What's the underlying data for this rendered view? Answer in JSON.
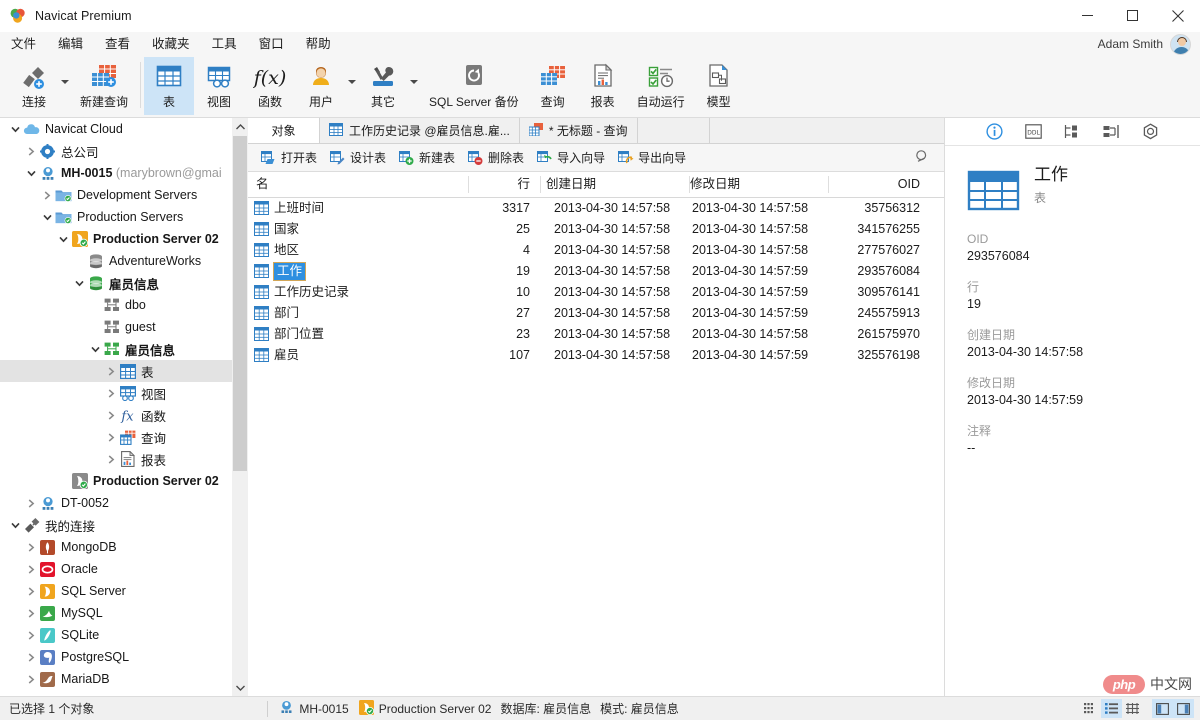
{
  "window": {
    "title": "Navicat Premium",
    "logo_icon": "navicat-logo-icon",
    "minimize_icon": "minimize-icon",
    "maximize_icon": "maximize-icon",
    "close_icon": "close-icon"
  },
  "menubar": {
    "items": [
      {
        "label": "文件"
      },
      {
        "label": "编辑"
      },
      {
        "label": "查看"
      },
      {
        "label": "收藏夹"
      },
      {
        "label": "工具"
      },
      {
        "label": "窗口"
      },
      {
        "label": "帮助"
      }
    ],
    "user_name": "Adam Smith",
    "avatar_icon": "avatar"
  },
  "ribbon": {
    "items": [
      {
        "label": "连接",
        "icon": "connection-icon",
        "has_caret": true,
        "active": false
      },
      {
        "label": "新建查询",
        "icon": "new-query-icon",
        "has_caret": false,
        "active": false
      },
      {
        "label": "表",
        "icon": "table-icon",
        "has_caret": false,
        "active": true
      },
      {
        "label": "视图",
        "icon": "view-icon",
        "has_caret": false,
        "active": false
      },
      {
        "label": "函数",
        "icon": "function-icon",
        "has_caret": false,
        "active": false
      },
      {
        "label": "用户",
        "icon": "user-icon",
        "has_caret": true,
        "active": false
      },
      {
        "label": "其它",
        "icon": "other-tools-icon",
        "has_caret": true,
        "active": false
      },
      {
        "label": "SQL Server 备份",
        "icon": "backup-icon",
        "has_caret": false,
        "active": false
      },
      {
        "label": "查询",
        "icon": "query-icon",
        "has_caret": false,
        "active": false
      },
      {
        "label": "报表",
        "icon": "report-icon",
        "has_caret": false,
        "active": false
      },
      {
        "label": "自动运行",
        "icon": "automation-icon",
        "has_caret": false,
        "active": false
      },
      {
        "label": "模型",
        "icon": "model-icon",
        "has_caret": false,
        "active": false
      }
    ]
  },
  "sidebar": {
    "scroll_up_icon": "chevron-up-icon",
    "scroll_down_icon": "chevron-down-icon",
    "items": [
      {
        "label": "Navicat Cloud",
        "icon": "cloud-icon",
        "indent": 0,
        "twisty": "down",
        "selected": false,
        "bold": false,
        "suffix": ""
      },
      {
        "label": "总公司",
        "icon": "gear-blue-icon",
        "indent": 1,
        "twisty": "right",
        "selected": false,
        "bold": false,
        "suffix": ""
      },
      {
        "label": "MH-0015",
        "icon": "project-icon",
        "indent": 1,
        "twisty": "down",
        "selected": false,
        "bold": true,
        "suffix": "(marybrown@gmai"
      },
      {
        "label": "Development Servers",
        "icon": "folder-ok-icon",
        "indent": 2,
        "twisty": "right",
        "selected": false,
        "bold": false,
        "suffix": ""
      },
      {
        "label": "Production Servers",
        "icon": "folder-ok-icon",
        "indent": 2,
        "twisty": "down",
        "selected": false,
        "bold": false,
        "suffix": ""
      },
      {
        "label": "Production Server 02",
        "icon": "sqlserver-ok-icon",
        "indent": 3,
        "twisty": "down",
        "selected": false,
        "bold": true,
        "suffix": ""
      },
      {
        "label": "AdventureWorks",
        "icon": "database-gray-icon",
        "indent": 4,
        "twisty": "none",
        "selected": false,
        "bold": false,
        "suffix": ""
      },
      {
        "label": "雇员信息",
        "icon": "database-green-icon",
        "indent": 4,
        "twisty": "down",
        "selected": false,
        "bold": true,
        "suffix": ""
      },
      {
        "label": "dbo",
        "icon": "schema-gray-icon",
        "indent": 5,
        "twisty": "none",
        "selected": false,
        "bold": false,
        "suffix": ""
      },
      {
        "label": "guest",
        "icon": "schema-gray-icon",
        "indent": 5,
        "twisty": "none",
        "selected": false,
        "bold": false,
        "suffix": ""
      },
      {
        "label": "雇员信息",
        "icon": "schema-green-icon",
        "indent": 5,
        "twisty": "down",
        "selected": false,
        "bold": true,
        "suffix": ""
      },
      {
        "label": "表",
        "icon": "table-icon",
        "indent": 6,
        "twisty": "right",
        "selected": true,
        "bold": false,
        "suffix": ""
      },
      {
        "label": "视图",
        "icon": "view-icon",
        "indent": 6,
        "twisty": "right",
        "selected": false,
        "bold": false,
        "suffix": ""
      },
      {
        "label": "函数",
        "icon": "function-icon",
        "indent": 6,
        "twisty": "right",
        "selected": false,
        "bold": false,
        "suffix": ""
      },
      {
        "label": "查询",
        "icon": "query-icon",
        "indent": 6,
        "twisty": "right",
        "selected": false,
        "bold": false,
        "suffix": ""
      },
      {
        "label": "报表",
        "icon": "report-icon",
        "indent": 6,
        "twisty": "right",
        "selected": false,
        "bold": false,
        "suffix": ""
      },
      {
        "label": "Production Server 02",
        "icon": "server-off-icon",
        "indent": 3,
        "twisty": "none",
        "selected": false,
        "bold": true,
        "suffix": ""
      },
      {
        "label": "DT-0052",
        "icon": "project-icon",
        "indent": 1,
        "twisty": "right",
        "selected": false,
        "bold": false,
        "suffix": ""
      },
      {
        "label": "我的连接",
        "icon": "connection-icon",
        "indent": 0,
        "twisty": "down",
        "selected": false,
        "bold": false,
        "suffix": ""
      },
      {
        "label": "MongoDB",
        "icon": "mongodb-icon",
        "indent": 1,
        "twisty": "right",
        "selected": false,
        "bold": false,
        "suffix": ""
      },
      {
        "label": "Oracle",
        "icon": "oracle-icon",
        "indent": 1,
        "twisty": "right",
        "selected": false,
        "bold": false,
        "suffix": ""
      },
      {
        "label": "SQL Server",
        "icon": "sqlserver-icon",
        "indent": 1,
        "twisty": "right",
        "selected": false,
        "bold": false,
        "suffix": ""
      },
      {
        "label": "MySQL",
        "icon": "mysql-icon",
        "indent": 1,
        "twisty": "right",
        "selected": false,
        "bold": false,
        "suffix": ""
      },
      {
        "label": "SQLite",
        "icon": "sqlite-icon",
        "indent": 1,
        "twisty": "right",
        "selected": false,
        "bold": false,
        "suffix": ""
      },
      {
        "label": "PostgreSQL",
        "icon": "postgresql-icon",
        "indent": 1,
        "twisty": "right",
        "selected": false,
        "bold": false,
        "suffix": ""
      },
      {
        "label": "MariaDB",
        "icon": "mariadb-icon",
        "indent": 1,
        "twisty": "right",
        "selected": false,
        "bold": false,
        "suffix": ""
      }
    ]
  },
  "tabs": {
    "object_label": "对象",
    "items": [
      {
        "label": "工作历史记录 @雇员信息.雇...",
        "icon": "table-icon",
        "active": false
      },
      {
        "label": "* 无标题 - 查询",
        "icon": "query-icon",
        "active": true
      }
    ]
  },
  "objectbar": {
    "buttons": [
      {
        "label": "打开表",
        "icon": "open-table-icon"
      },
      {
        "label": "设计表",
        "icon": "design-table-icon"
      },
      {
        "label": "新建表",
        "icon": "new-table-icon"
      },
      {
        "label": "删除表",
        "icon": "delete-table-icon"
      },
      {
        "label": "导入向导",
        "icon": "import-wizard-icon"
      },
      {
        "label": "导出向导",
        "icon": "export-wizard-icon"
      }
    ],
    "search_icon": "search-icon"
  },
  "table": {
    "columns": [
      {
        "label": "名",
        "align": "left"
      },
      {
        "label": "行",
        "align": "right"
      },
      {
        "label": "创建日期",
        "align": "left"
      },
      {
        "label": "修改日期",
        "align": "left"
      },
      {
        "label": "OID",
        "align": "right"
      }
    ],
    "rows": [
      {
        "name": "上班时间",
        "rows": "3317",
        "created": "2013-04-30 14:57:58",
        "modified": "2013-04-30 14:57:58",
        "oid": "35756312",
        "selected": false
      },
      {
        "name": "国家",
        "rows": "25",
        "created": "2013-04-30 14:57:58",
        "modified": "2013-04-30 14:57:58",
        "oid": "341576255",
        "selected": false
      },
      {
        "name": "地区",
        "rows": "4",
        "created": "2013-04-30 14:57:58",
        "modified": "2013-04-30 14:57:58",
        "oid": "277576027",
        "selected": false
      },
      {
        "name": "工作",
        "rows": "19",
        "created": "2013-04-30 14:57:58",
        "modified": "2013-04-30 14:57:59",
        "oid": "293576084",
        "selected": true
      },
      {
        "name": "工作历史记录",
        "rows": "10",
        "created": "2013-04-30 14:57:58",
        "modified": "2013-04-30 14:57:59",
        "oid": "309576141",
        "selected": false
      },
      {
        "name": "部门",
        "rows": "27",
        "created": "2013-04-30 14:57:58",
        "modified": "2013-04-30 14:57:59",
        "oid": "245575913",
        "selected": false
      },
      {
        "name": "部门位置",
        "rows": "23",
        "created": "2013-04-30 14:57:58",
        "modified": "2013-04-30 14:57:58",
        "oid": "261575970",
        "selected": false
      },
      {
        "name": "雇员",
        "rows": "107",
        "created": "2013-04-30 14:57:58",
        "modified": "2013-04-30 14:57:59",
        "oid": "325576198",
        "selected": false
      }
    ]
  },
  "infopanel": {
    "tabs": [
      {
        "icon": "info-icon",
        "active": true
      },
      {
        "icon": "ddl-icon",
        "active": false
      },
      {
        "icon": "relation-icon",
        "active": false
      },
      {
        "icon": "columns-icon",
        "active": false
      },
      {
        "icon": "preview-icon",
        "active": false
      }
    ],
    "object_icon": "table-big-icon",
    "object_title": "工作",
    "object_subtitle": "表",
    "fields": [
      {
        "key": "OID",
        "value": "293576084"
      },
      {
        "key": "行",
        "value": "19"
      },
      {
        "key": "创建日期",
        "value": "2013-04-30 14:57:58"
      },
      {
        "key": "修改日期",
        "value": "2013-04-30 14:57:59"
      },
      {
        "key": "注释",
        "value": "--"
      }
    ]
  },
  "statusbar": {
    "selection_text": "已选择 1 个对象",
    "project_icon": "project-icon",
    "project_name": "MH-0015",
    "server_icon": "sqlserver-ok-icon",
    "server_name": "Production Server 02",
    "database_text": "数据库: 雇员信息",
    "schema_text": "模式: 雇员信息",
    "view_buttons": [
      {
        "icon": "detail-grid-icon",
        "active": false
      },
      {
        "icon": "list-view-icon",
        "active": true
      },
      {
        "icon": "grid-view-icon",
        "active": false
      },
      {
        "icon": "pane-left-icon",
        "active": true
      },
      {
        "icon": "pane-right-icon",
        "active": true
      }
    ]
  },
  "watermark": {
    "badge": "php",
    "text": "中文网"
  }
}
